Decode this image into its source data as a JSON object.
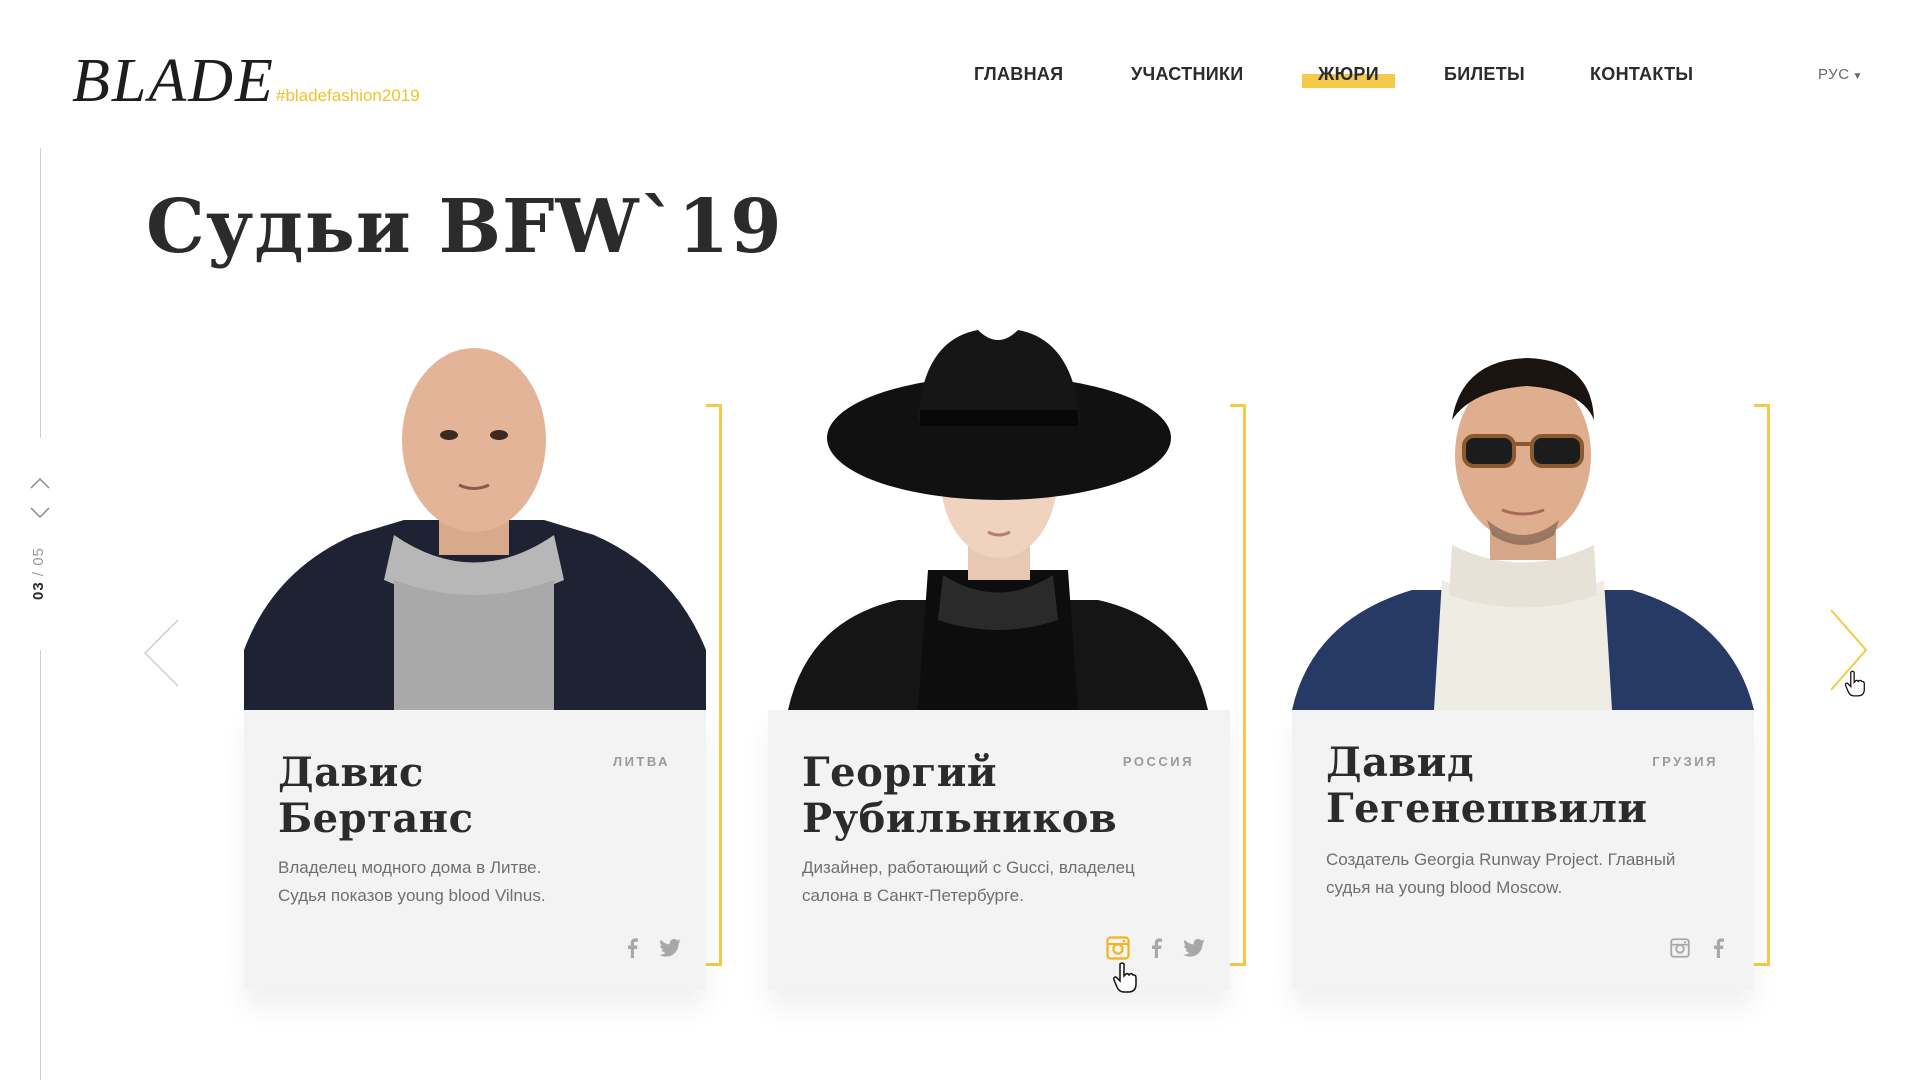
{
  "header": {
    "logo": "BLADE",
    "hashtag": "#bladefashion2019",
    "nav": [
      {
        "label": "ГЛАВНАЯ",
        "active": false
      },
      {
        "label": "УЧАСТНИКИ",
        "active": false
      },
      {
        "label": "ЖЮРИ",
        "active": true
      },
      {
        "label": "БИЛЕТЫ",
        "active": false
      },
      {
        "label": "КОНТАКТЫ",
        "active": false
      }
    ],
    "language": "РУС"
  },
  "pager": {
    "current": "03",
    "separator": "/",
    "total": "05"
  },
  "page_title": "Судьи BFW`19",
  "judges": [
    {
      "name_line1": "Давис",
      "name_line2": "Бертанс",
      "country": "ЛИТВА",
      "desc_line1": "Владелец модного дома в Литве.",
      "desc_line2": "Судья показов young blood Vilnus.",
      "socials": [
        "facebook-icon",
        "twitter-icon"
      ]
    },
    {
      "name_line1": "Георгий",
      "name_line2": "Рубильников",
      "country": "РОССИЯ",
      "desc_line1": "Дизайнер, работающий с Gucci, владелец",
      "desc_line2": "салона в Санкт-Петербурге.",
      "socials": [
        "instagram-icon",
        "facebook-icon",
        "twitter-icon"
      ]
    },
    {
      "name_line1": "Давид",
      "name_line2": "Гегенешвили",
      "country": "ГРУЗИЯ",
      "desc_line1": "Создатель Georgia Runway Project. Главный",
      "desc_line2": "судья на young blood Moscow.",
      "socials": [
        "instagram-icon",
        "facebook-icon"
      ]
    }
  ],
  "colors": {
    "accent": "#f5c94a",
    "hashtag": "#f2c12e",
    "text": "#2b2b2b",
    "card_bg": "#f3f3f3",
    "muted": "#9a9a9a"
  }
}
